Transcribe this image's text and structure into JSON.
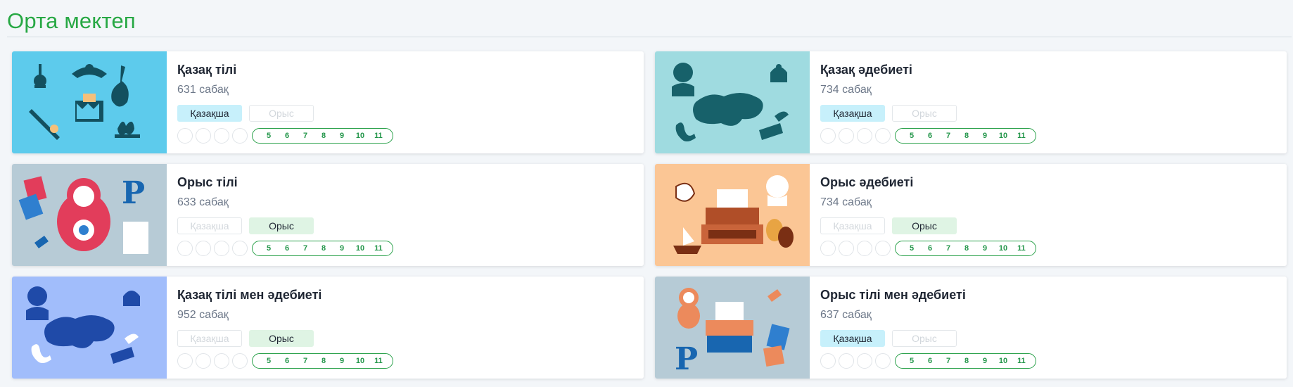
{
  "section_title": "Орта мектеп",
  "colors": {
    "accent": "#27a844",
    "kz_active": "#c7f0fb",
    "ru_active": "#dff4e4"
  },
  "cards": [
    {
      "title": "Қазақ тілі",
      "lessons": "631 сабақ",
      "lang_kz": "Қазақша",
      "lang_ru": "Орыс",
      "active": "kz",
      "thumb_bg": "#5dcbec",
      "thumb_icon": "kazakh-symbols-icon",
      "grades": [
        "5",
        "6",
        "7",
        "8",
        "9",
        "10",
        "11"
      ]
    },
    {
      "title": "Қазақ әдебиеті",
      "lessons": "734 сабақ",
      "lang_kz": "Қазақша",
      "lang_ru": "Орыс",
      "active": "kz",
      "thumb_bg": "#9fdbe0",
      "thumb_icon": "kazakh-literature-icon",
      "grades": [
        "5",
        "6",
        "7",
        "8",
        "9",
        "10",
        "11"
      ]
    },
    {
      "title": "Орыс тілі",
      "lessons": "633 сабақ",
      "lang_kz": "Қазақша",
      "lang_ru": "Орыс",
      "active": "ru",
      "thumb_bg": "#b7cbd6",
      "thumb_icon": "matryoshka-icon",
      "grades": [
        "5",
        "6",
        "7",
        "8",
        "9",
        "10",
        "11"
      ]
    },
    {
      "title": "Орыс әдебиеті",
      "lessons": "734 сабақ",
      "lang_kz": "Қазақша",
      "lang_ru": "Орыс",
      "active": "ru",
      "thumb_bg": "#fbc695",
      "thumb_icon": "typewriter-icon",
      "grades": [
        "5",
        "6",
        "7",
        "8",
        "9",
        "10",
        "11"
      ]
    },
    {
      "title": "Қазақ тілі мен әдебиеті",
      "lessons": "952 сабақ",
      "lang_kz": "Қазақша",
      "lang_ru": "Орыс",
      "active": "ru",
      "thumb_bg": "#a1bdfb",
      "thumb_icon": "kazakh-map-icon",
      "grades": [
        "5",
        "6",
        "7",
        "8",
        "9",
        "10",
        "11"
      ]
    },
    {
      "title": "Орыс тілі мен әдебиеті",
      "lessons": "637 сабақ",
      "lang_kz": "Қазақша",
      "lang_ru": "Орыс",
      "active": "kz",
      "thumb_bg": "#b6cbd6",
      "thumb_icon": "russian-literature-icon",
      "grades": [
        "5",
        "6",
        "7",
        "8",
        "9",
        "10",
        "11"
      ]
    }
  ]
}
